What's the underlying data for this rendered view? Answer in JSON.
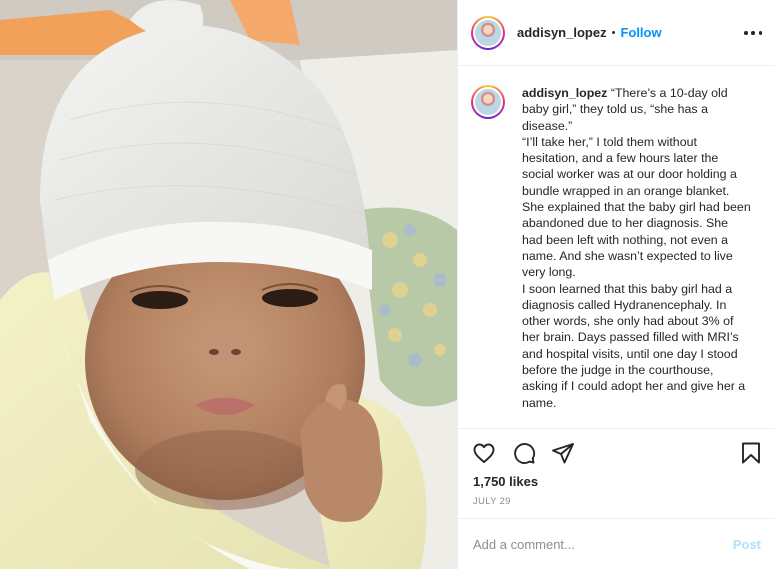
{
  "post": {
    "username": "addisyn_lopez",
    "follow_label": "Follow",
    "separator": "•",
    "caption_lines": [
      "“There’s a 10-day old baby girl,” they told us, “she has a disease.”",
      "“I’ll take her,” I told them without hesitation, and a few hours later the social worker was at our door holding a bundle wrapped in an orange blanket. She explained that the baby girl had been abandoned due to her diagnosis. She had been left with nothing, not even a name. And she wasn’t expected to live very long.",
      "I soon learned that this baby girl had a diagnosis called Hydranencephaly. In other words, she only had about 3% of her brain. Days passed filled with MRI’s and hospital visits, until one day I stood before the judge in the courthouse, asking if I could adopt her and give her a name."
    ],
    "likes": "1,750 likes",
    "date": "JULY 29",
    "comment_placeholder": "Add a comment...",
    "post_label": "Post"
  },
  "icons": {
    "more": "more-options-icon",
    "like": "heart-icon",
    "comment": "comment-icon",
    "share": "share-icon",
    "save": "bookmark-icon"
  },
  "colors": {
    "link_blue": "#0095f6",
    "post_disabled": "#b2dffc",
    "muted": "#8e8e8e",
    "text": "#262626"
  }
}
